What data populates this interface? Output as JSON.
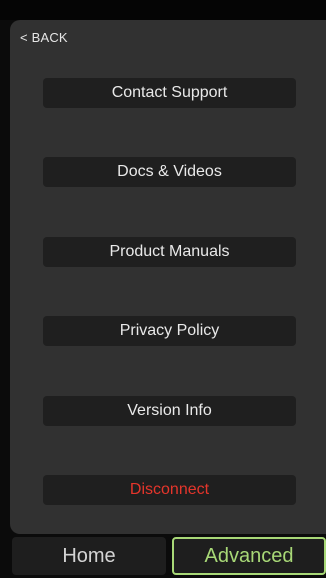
{
  "header": {
    "back_label": "< BACK"
  },
  "menu": {
    "items": [
      {
        "label": "Contact Support"
      },
      {
        "label": "Docs & Videos"
      },
      {
        "label": "Product Manuals"
      },
      {
        "label": "Privacy Policy"
      },
      {
        "label": "Version Info"
      },
      {
        "label": "Disconnect"
      }
    ]
  },
  "tabs": {
    "home_label": "Home",
    "advanced_label": "Advanced",
    "active": "Advanced"
  },
  "colors": {
    "accent": "#a8d877",
    "danger": "#e5352b",
    "panel": "#313131",
    "button": "#1f1f1f"
  }
}
